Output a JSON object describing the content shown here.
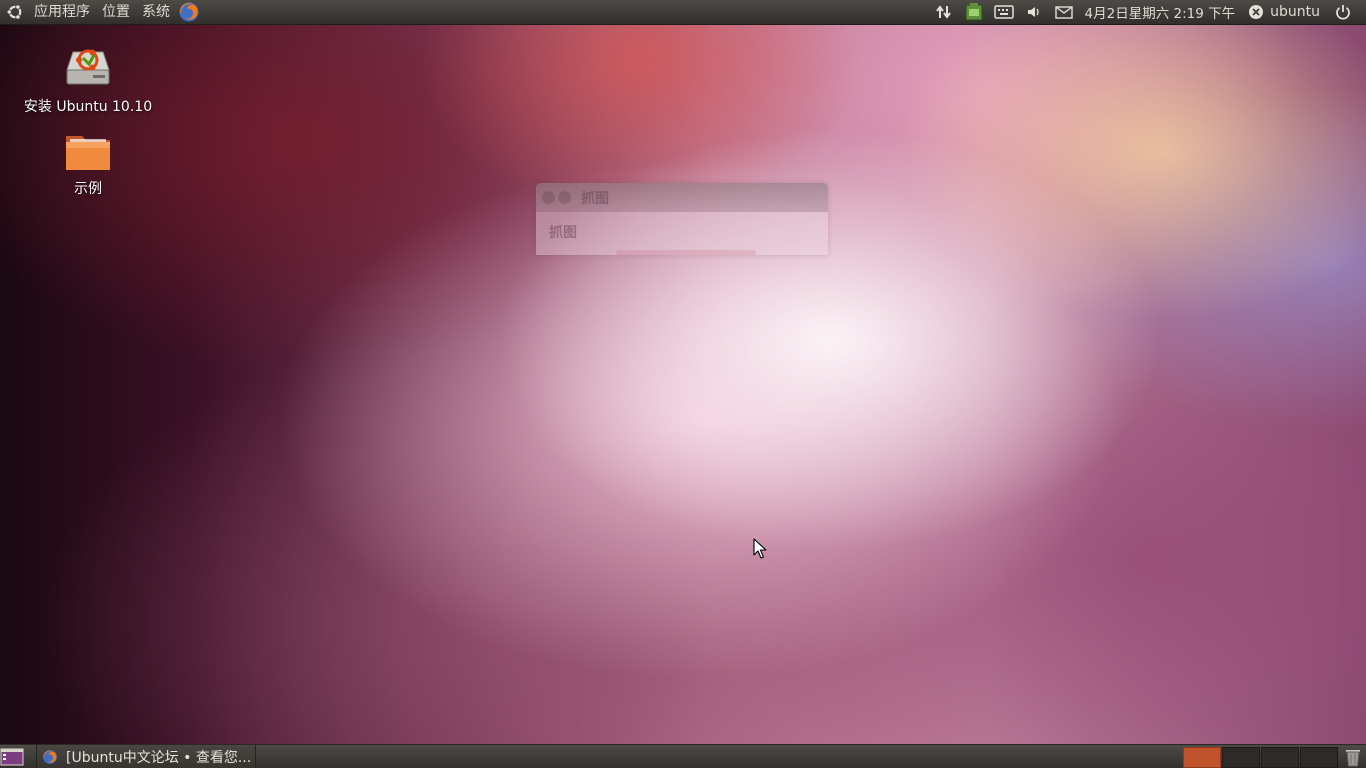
{
  "top_panel": {
    "menu": {
      "applications": "应用程序",
      "places": "位置",
      "system": "系统"
    },
    "clock": "4月2日星期六 2:19 下午",
    "user": "ubuntu",
    "icons": [
      "ubuntu-logo-icon",
      "firefox-icon",
      "network-updown-icon",
      "battery-icon",
      "keyboard-icon",
      "volume-icon",
      "mail-icon",
      "user-status-icon",
      "power-icon"
    ]
  },
  "desktop": {
    "icons": [
      {
        "label": "安装 Ubuntu 10.10",
        "icon": "install-drive-icon"
      },
      {
        "label": "示例",
        "icon": "folder-icon"
      }
    ]
  },
  "ghost_window": {
    "title": "抓图",
    "heading": "抓图"
  },
  "bottom_panel": {
    "task": "[Ubuntu中文论坛 • 查看您...",
    "workspace_count": 4,
    "active_workspace": 1
  },
  "colors": {
    "panel": "#3b3a37",
    "panel_text": "#dfdbd2",
    "workspace_active": "#c0532b",
    "ubuntu_orange": "#dd4814"
  }
}
